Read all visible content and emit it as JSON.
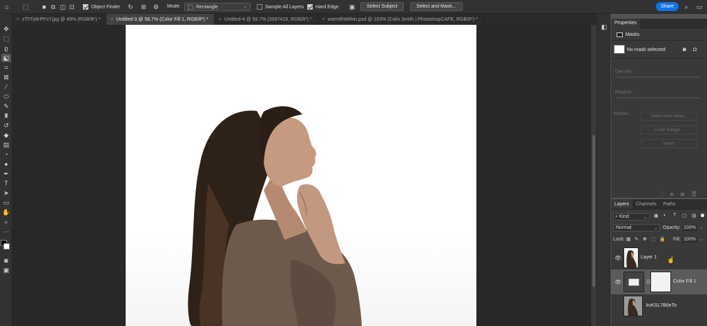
{
  "options_bar": {
    "object_finder_label": "Object Finder",
    "mode_label": "Mode:",
    "mode_value": "Rectangle",
    "sample_all_layers_label": "Sample All Layers",
    "sample_all_layers_checked": false,
    "hard_edge_label": "Hard Edge",
    "hard_edge_checked": true,
    "select_subject_label": "Select Subject",
    "select_and_mask_label": "Select and Mask...",
    "share_label": "Share"
  },
  "tabs": [
    {
      "label": "zThTy8rPPsY.jpg @ 49% (RGB/8*) *",
      "active": false
    },
    {
      "label": "Untitled-3 @ 58.7% (Color Fill 1, RGB/8*) *",
      "active": true
    },
    {
      "label": "Untitled-4 @ 58.7% (3097419, RGB/8*) *",
      "active": false
    },
    {
      "label": "warmthWithin.psd @ 163% (Colin Smith | PhotoshopCAFE, RGB/8*) *",
      "active": false
    }
  ],
  "properties": {
    "title": "Properties",
    "section": "Masks",
    "mask_status": "No mask selected",
    "density_label": "Density:",
    "feather_label": "Feather:",
    "refine_label": "Refine:",
    "select_and_mask_btn": "Select and Mask...",
    "color_range_btn": "Color Range...",
    "invert_btn": "Invert"
  },
  "layers_panel": {
    "tabs": [
      "Layers",
      "Channels",
      "Paths"
    ],
    "kind_label": "Kind",
    "blend_mode": "Normal",
    "opacity_label": "Opacity:",
    "opacity_value": "100%",
    "lock_label": "Lock:",
    "fill_label": "Fill:",
    "fill_value": "100%",
    "layers": [
      {
        "name": "Layer 1"
      },
      {
        "name": "Color Fill 1"
      },
      {
        "name": "kvKSL7B6eTo"
      }
    ]
  },
  "colors": {
    "share_button": "#1473e6",
    "canvas_bg": "#282828",
    "panel_bg": "#393939"
  }
}
